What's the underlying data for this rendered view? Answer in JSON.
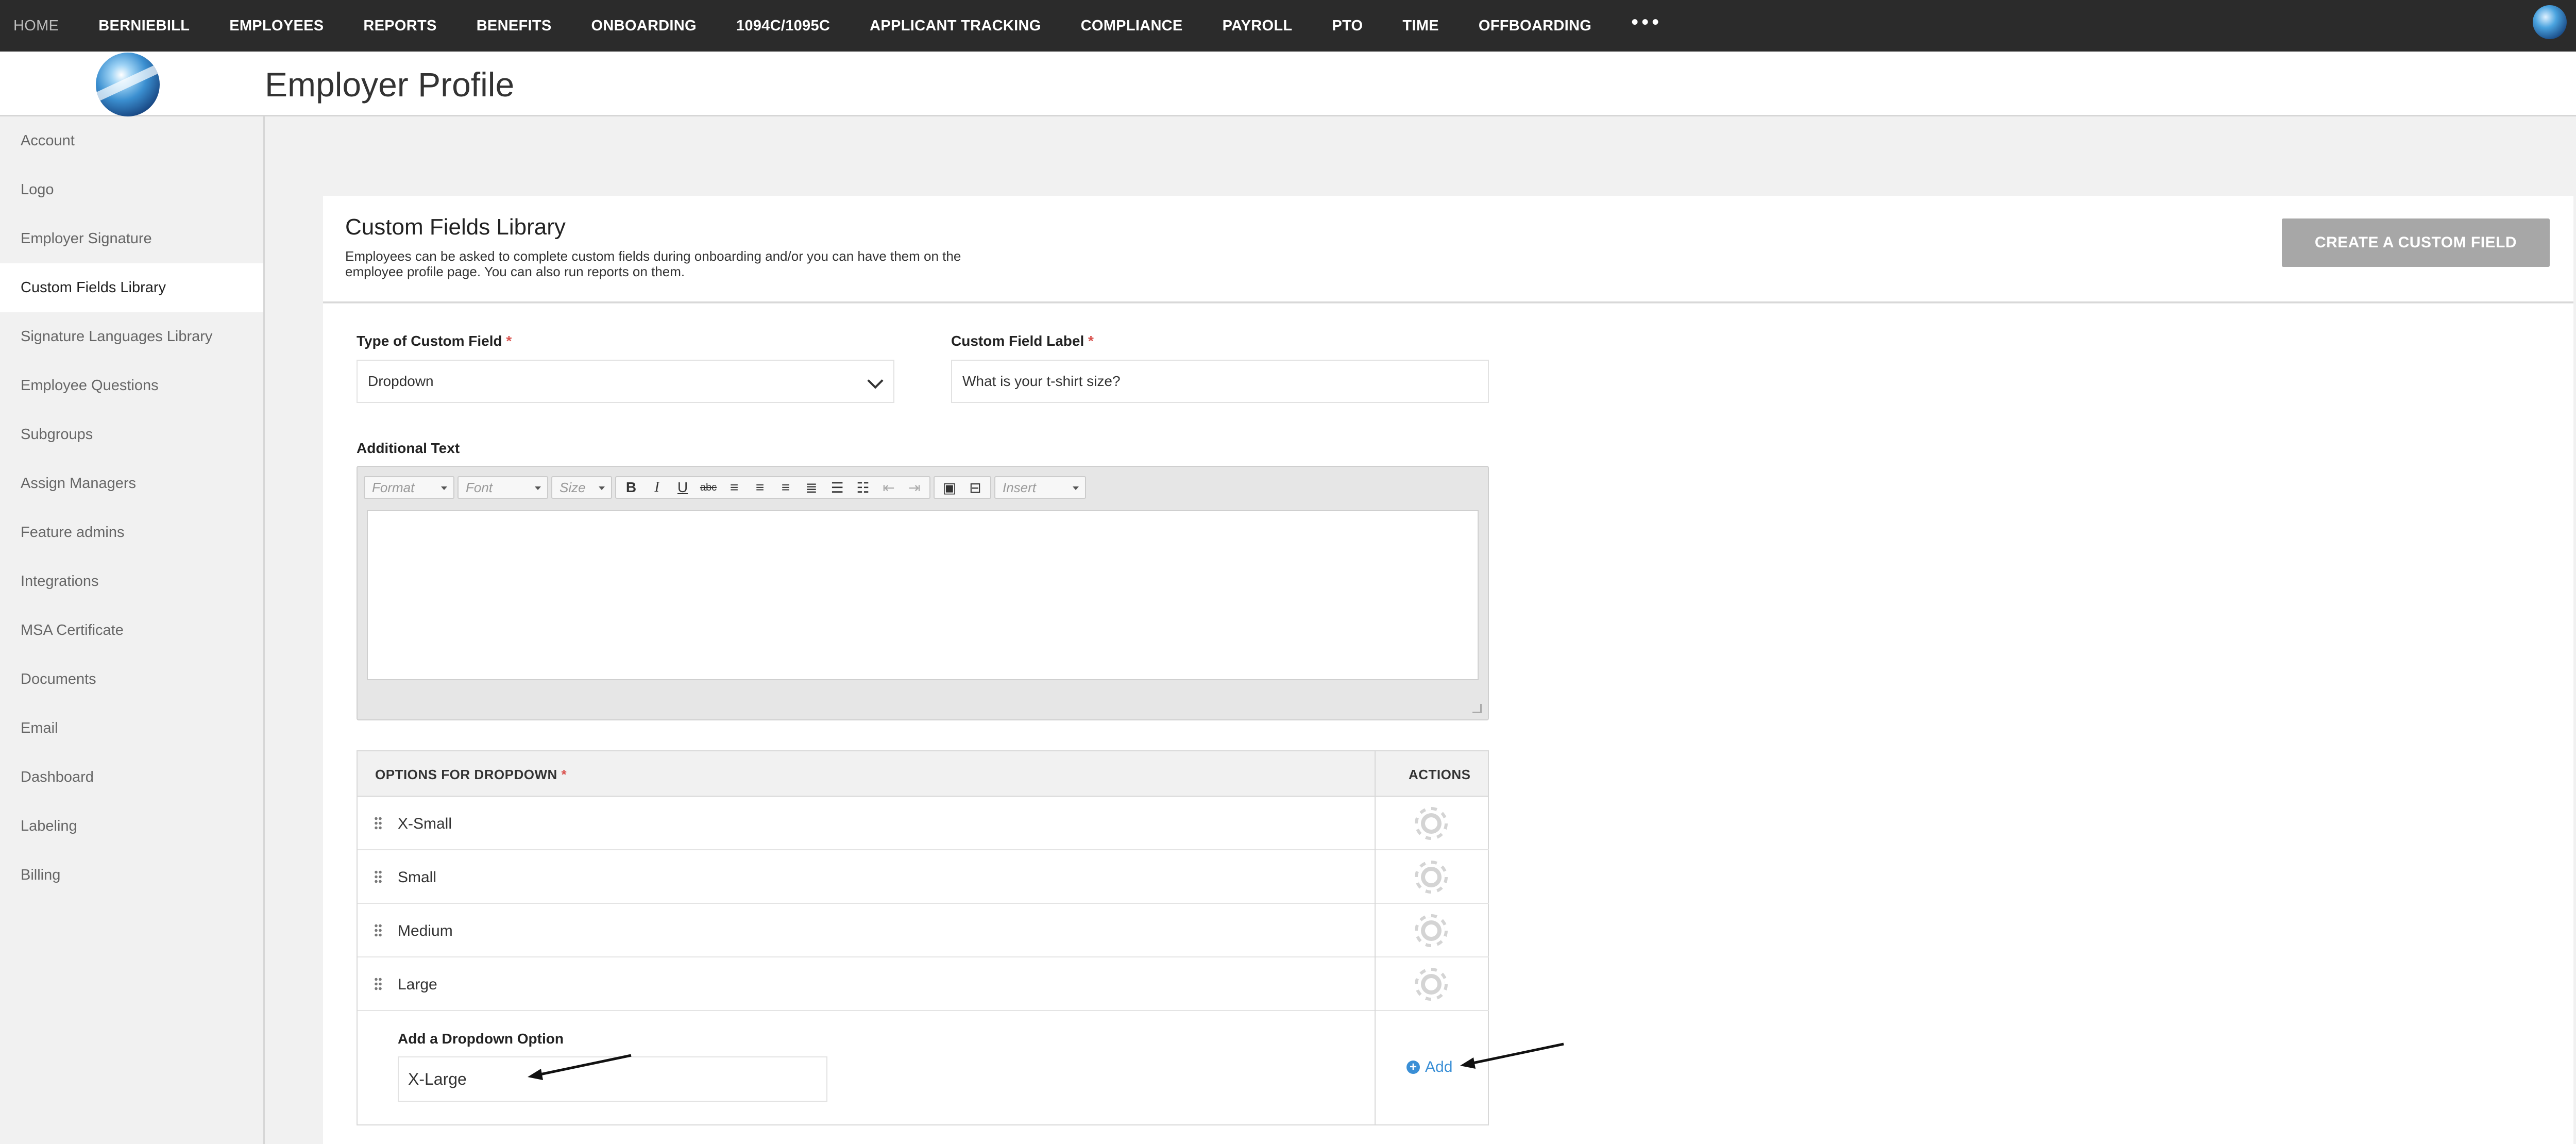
{
  "nav": {
    "items": [
      "HOME",
      "BERNIEBILL",
      "EMPLOYEES",
      "REPORTS",
      "BENEFITS",
      "ONBOARDING",
      "1094C/1095C",
      "APPLICANT TRACKING",
      "COMPLIANCE",
      "PAYROLL",
      "PTO",
      "TIME",
      "OFFBOARDING"
    ],
    "more": "•••"
  },
  "header": {
    "title": "Employer Profile"
  },
  "sidebar": {
    "items": [
      "Account",
      "Logo",
      "Employer Signature",
      "Custom Fields Library",
      "Signature Languages Library",
      "Employee Questions",
      "Subgroups",
      "Assign Managers",
      "Feature admins",
      "Integrations",
      "MSA Certificate",
      "Documents",
      "Email",
      "Dashboard",
      "Labeling",
      "Billing"
    ],
    "active": "Custom Fields Library"
  },
  "card": {
    "title": "Custom Fields Library",
    "description": "Employees can be asked to complete custom fields during onboarding and/or you can have them on the employee profile page. You can also run reports on them.",
    "create_button": "CREATE A CUSTOM FIELD"
  },
  "form": {
    "type_label": "Type of Custom Field",
    "type_value": "Dropdown",
    "label_label": "Custom Field Label",
    "label_value": "What is your t-shirt size?",
    "required_mark": "*",
    "additional_text_label": "Additional Text"
  },
  "editor": {
    "format": "Format",
    "font": "Font",
    "size": "Size",
    "insert": "Insert",
    "bold": "B",
    "italic": "I",
    "underline": "U",
    "strike": "abc"
  },
  "options": {
    "header": "OPTIONS FOR DROPDOWN",
    "actions_header": "ACTIONS",
    "items": [
      "X-Small",
      "Small",
      "Medium",
      "Large"
    ],
    "add_label": "Add a Dropdown Option",
    "add_value": "X-Large",
    "add_link": "Add"
  },
  "icons": {
    "gear": "gear-icon",
    "drag": "drag-handle-icon",
    "plus": "plus-circle-icon",
    "chevron": "chevron-down-icon"
  },
  "colors": {
    "nav_bg": "#2b2b2b",
    "button_disabled": "#a7a7a7",
    "link": "#3a8fd6",
    "required": "#d9534f"
  }
}
